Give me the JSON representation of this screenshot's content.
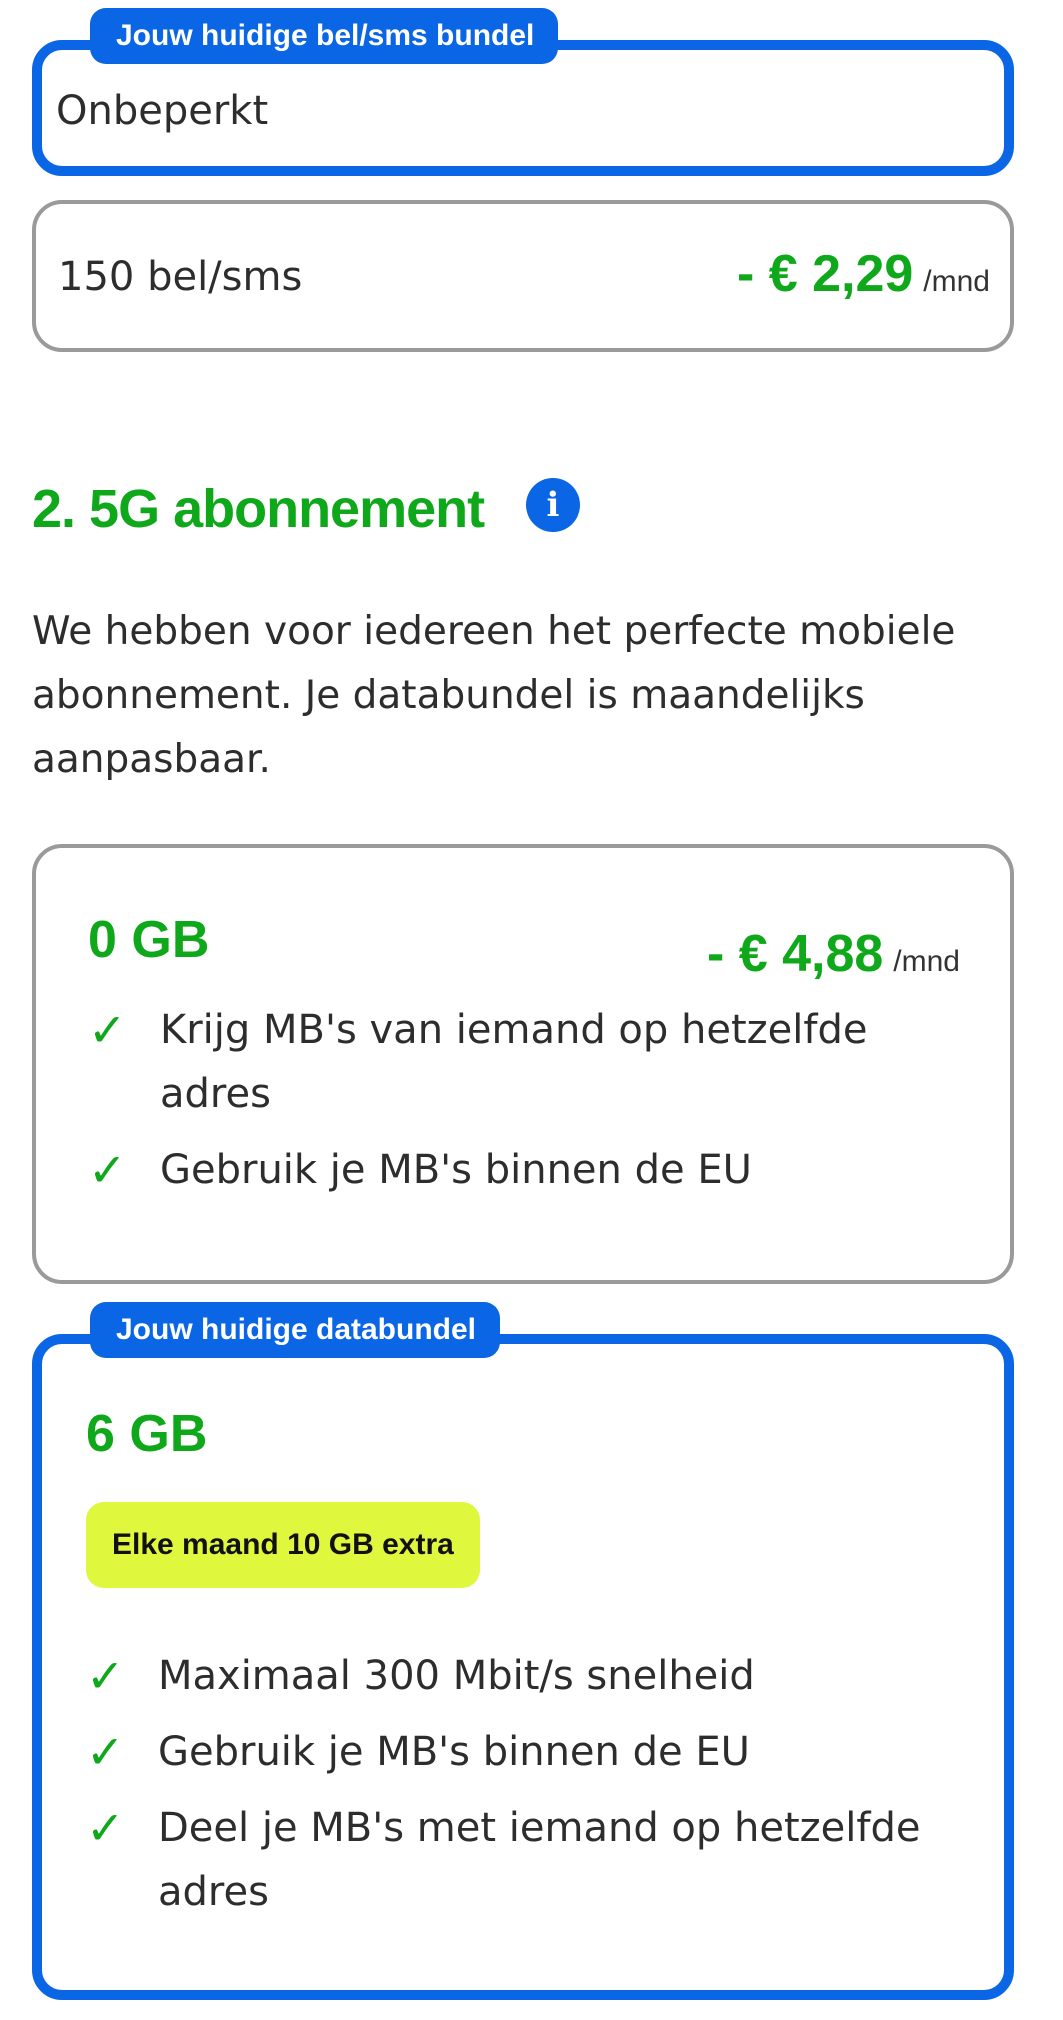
{
  "sms_section": {
    "current_tag": "Jouw huidige bel/sms bundel",
    "current_option": "Onbeperkt",
    "alt_option": {
      "label": "150 bel/sms",
      "price": "- € 2,29",
      "unit": "/mnd"
    }
  },
  "abonnement": {
    "heading": "2. 5G abonnement",
    "info_icon": "info-icon",
    "intro": "We hebben voor iedereen het perfecte mobiele abonnement. Je databundel is maandelijks aanpasbaar.",
    "plans": [
      {
        "name": "0 GB",
        "price": "- € 4,88",
        "unit": "/mnd",
        "features": [
          "Krijg MB's van iemand op hetzelfde adres",
          "Gebruik je MB's binnen de EU"
        ]
      },
      {
        "tag": "Jouw huidige databundel",
        "name": "6 GB",
        "badge": "Elke maand 10 GB extra",
        "features": [
          "Maximaal 300 Mbit/s snelheid",
          "Gebruik je MB's binnen de EU",
          "Deel je MB's met iemand op hetzelfde adres"
        ]
      }
    ]
  },
  "colors": {
    "accent_blue": "#0a66e4",
    "price_green": "#0fa81b",
    "badge_yellow": "#dff73c"
  }
}
